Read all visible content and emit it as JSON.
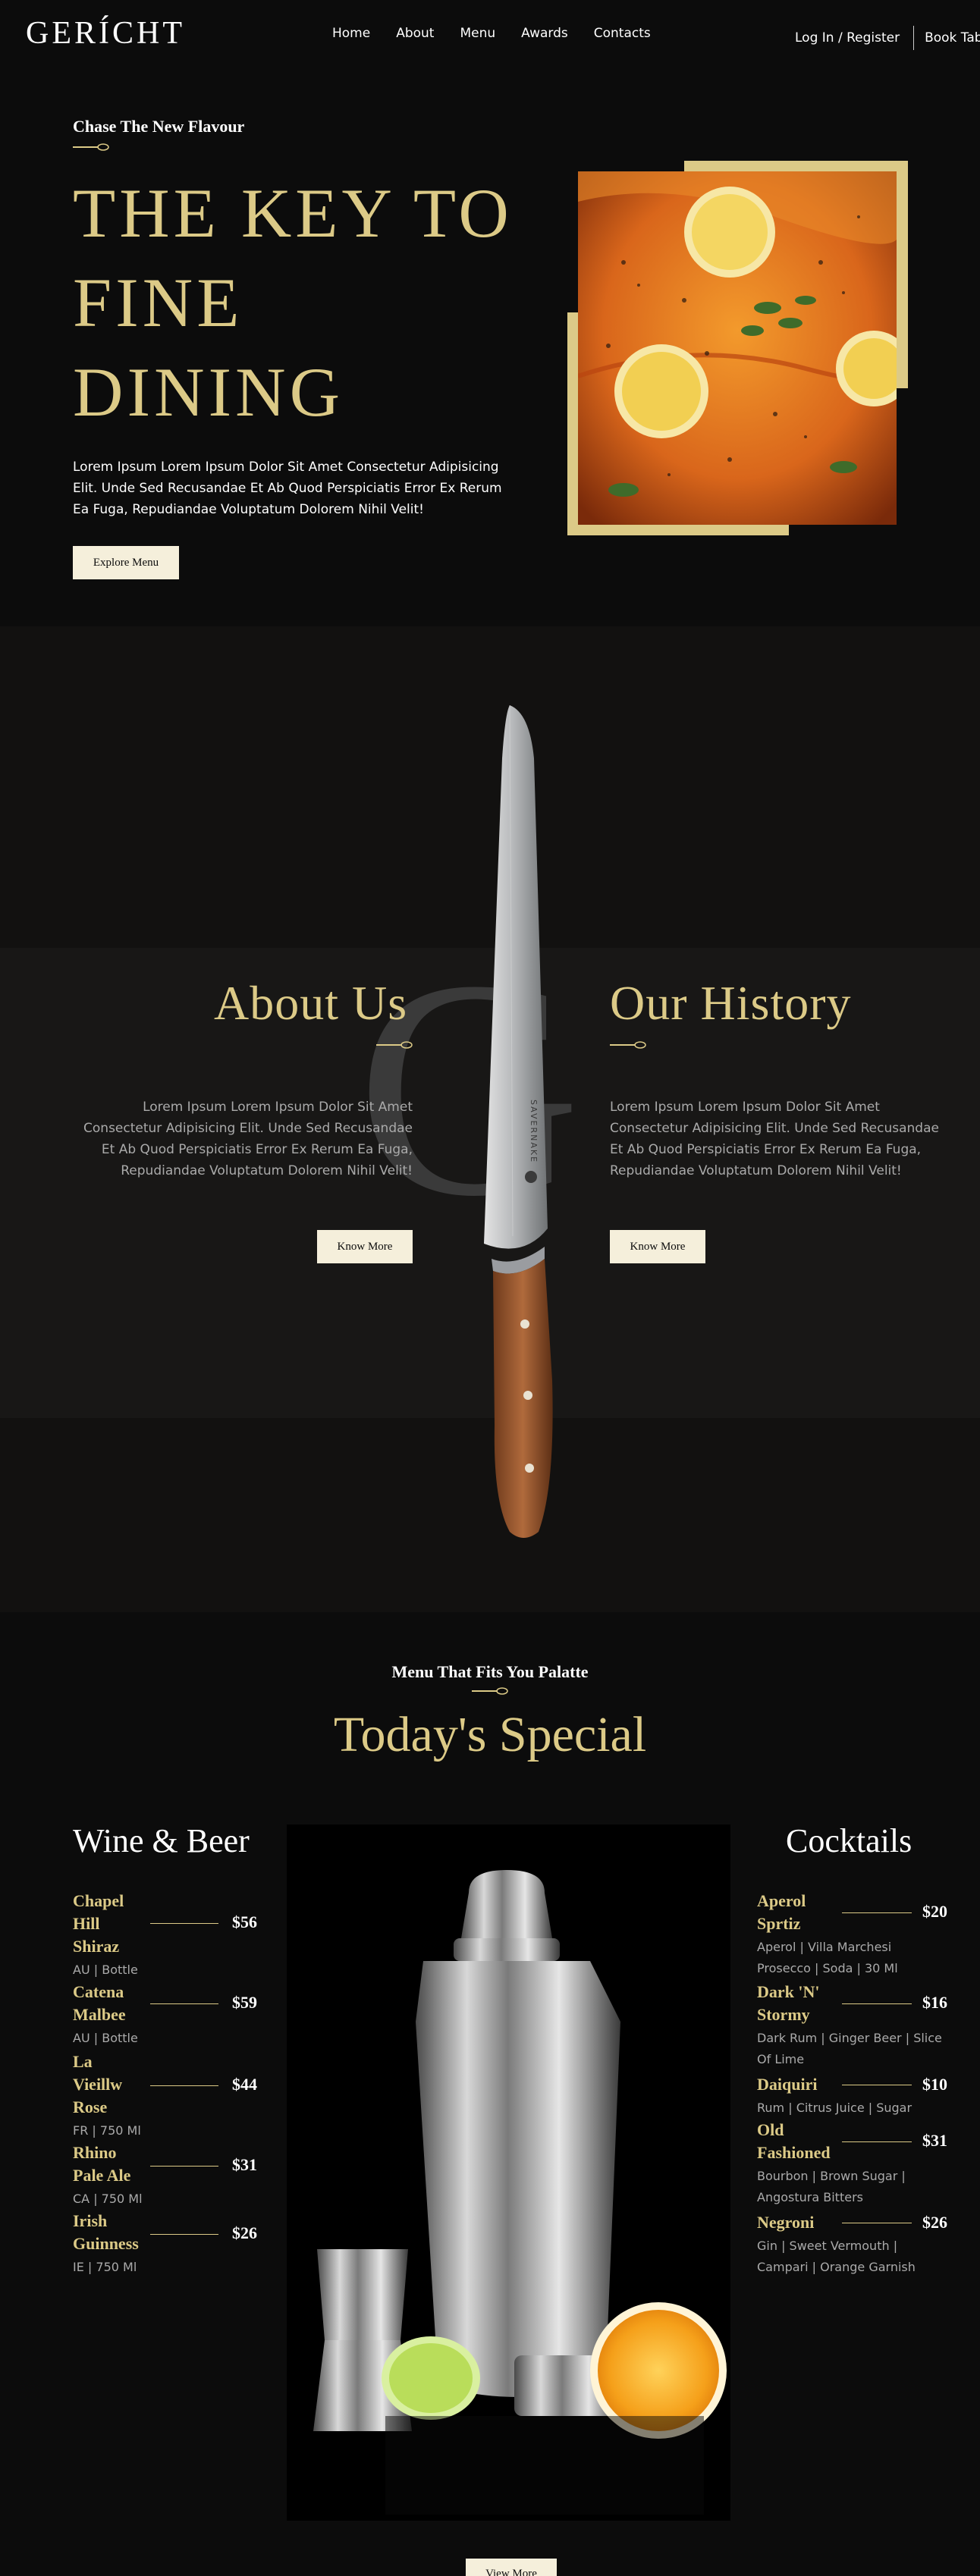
{
  "nav": {
    "logo": "GERÍCHT",
    "links": [
      "Home",
      "About",
      "Menu",
      "Awards",
      "Contacts"
    ],
    "login": "Log In / Register",
    "book": "Book Table"
  },
  "hero": {
    "subtitle": "Chase The New Flavour",
    "title_lines": [
      "THE KEY TO",
      "FINE",
      "DINING"
    ],
    "description": "Lorem Ipsum Lorem Ipsum Dolor Sit Amet Consectetur Adipisicing Elit. Unde Sed Recusandae Et Ab Quod Perspiciatis Error Ex Rerum Ea Fuga, Repudiandae Voluptatum Dolorem Nihil Velit!",
    "button": "Explore Menu"
  },
  "about": {
    "bg_letter": "G",
    "knife_brand": "SAVERNAKE",
    "about_title": "About Us",
    "about_text": "Lorem Ipsum Lorem Ipsum Dolor Sit Amet Consectetur Adipisicing Elit. Unde Sed Recusandae Et Ab Quod Perspiciatis Error Ex Rerum Ea Fuga, Repudiandae Voluptatum Dolorem Nihil Velit!",
    "about_button": "Know More",
    "history_title": "Our History",
    "history_text": "Lorem Ipsum Lorem Ipsum Dolor Sit Amet Consectetur Adipisicing Elit. Unde Sed Recusandae Et Ab Quod Perspiciatis Error Ex Rerum Ea Fuga, Repudiandae Voluptatum Dolorem Nihil Velit!",
    "history_button": "Know More"
  },
  "specials": {
    "subtitle": "Menu That Fits You Palatte",
    "title": "Today's Special",
    "wine_title": "Wine & Beer",
    "wine": [
      {
        "name": "Chapel Hill Shiraz",
        "price": "$56",
        "desc": "AU | Bottle"
      },
      {
        "name": "Catena Malbee",
        "price": "$59",
        "desc": "AU | Bottle"
      },
      {
        "name": "La Vieillw Rose",
        "price": "$44",
        "desc": "FR | 750 Ml"
      },
      {
        "name": "Rhino Pale Ale",
        "price": "$31",
        "desc": "CA | 750 Ml"
      },
      {
        "name": "Irish Guinness",
        "price": "$26",
        "desc": "IE | 750 Ml"
      }
    ],
    "cocktail_title": "Cocktails",
    "cocktails": [
      {
        "name": "Aperol Sprtiz",
        "price": "$20",
        "desc": "Aperol | Villa Marchesi Prosecco | Soda | 30 Ml"
      },
      {
        "name": "Dark 'N' Stormy",
        "price": "$16",
        "desc": "Dark Rum | Ginger Beer | Slice Of Lime"
      },
      {
        "name": "Daiquiri",
        "price": "$10",
        "desc": "Rum | Citrus Juice | Sugar"
      },
      {
        "name": "Old Fashioned",
        "price": "$31",
        "desc": "Bourbon | Brown Sugar | Angostura Bitters"
      },
      {
        "name": "Negroni",
        "price": "$26",
        "desc": "Gin | Sweet Vermouth | Campari | Orange Garnish"
      }
    ],
    "view_more": "View More"
  },
  "colors": {
    "gold": "#dcca87",
    "background": "#0c0c0c",
    "button_bg": "#f5efdb"
  }
}
